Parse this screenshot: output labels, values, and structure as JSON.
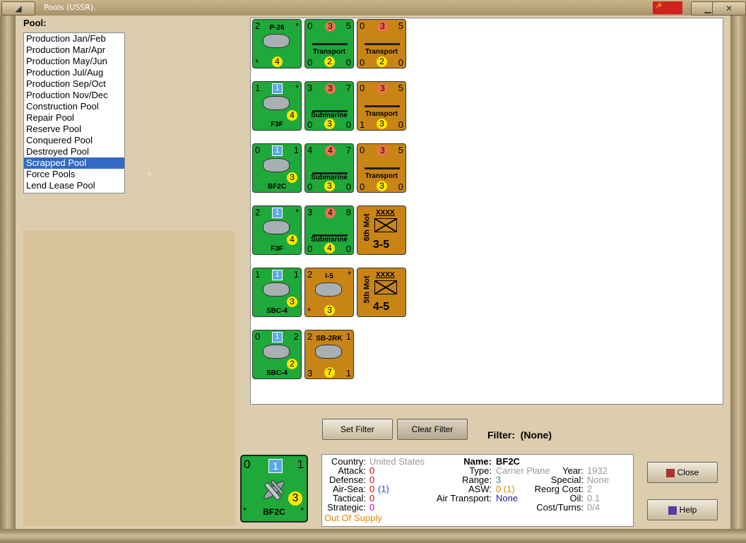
{
  "window": {
    "title": "Pools (USSR)."
  },
  "pool_label": "Pool:",
  "pools": [
    "Production Jan/Feb",
    "Production Mar/Apr",
    "Production May/Jun",
    "Production Jul/Aug",
    "Production Sep/Oct",
    "Production Nov/Dec",
    "Construction Pool",
    "Repair Pool",
    "Reserve Pool",
    "Conquered Pool",
    "Destroyed Pool",
    "Scrapped Pool",
    "Force Pools",
    "Lend Lease Pool"
  ],
  "selected_pool": "Scrapped Pool",
  "counters": [
    {
      "tl": "2",
      "name": "P-26",
      "tr": "*",
      "bl": "*",
      "mid": "4"
    },
    {
      "tl": "0",
      "red": "3",
      "tr": "5",
      "name": "Transport",
      "bl": "0",
      "mid": "2",
      "br": "0"
    },
    {
      "tl": "0",
      "red": "3",
      "tr": "5",
      "name": "Transport",
      "bl": "0",
      "mid": "2",
      "br": "0"
    },
    {
      "tl": "1",
      "blue": "1",
      "tr": "*",
      "name": "F3F",
      "mid": "4"
    },
    {
      "tl": "3",
      "red": "3",
      "tr": "7",
      "name": "Submarine",
      "bl": "0",
      "mid": "3",
      "br": "0"
    },
    {
      "tl": "0",
      "red": "3",
      "tr": "5",
      "name": "Transport",
      "bl": "1",
      "mid": "3",
      "br": "0"
    },
    {
      "tl": "0",
      "blue": "1",
      "tr": "1",
      "name": "BF2C",
      "mid": "3"
    },
    {
      "tl": "4",
      "red": "4",
      "tr": "7",
      "name": "Submarine",
      "bl": "0",
      "mid": "3",
      "br": "0"
    },
    {
      "tl": "0",
      "red": "3",
      "tr": "5",
      "name": "Transport",
      "bl": "0",
      "mid": "3",
      "br": "0"
    },
    {
      "tl": "2",
      "blue": "1",
      "tr": "*",
      "name": "F3F",
      "mid": "4"
    },
    {
      "tl": "3",
      "red": "4",
      "tr": "8",
      "name": "Submarine",
      "bl": "0",
      "mid": "4",
      "br": "0"
    },
    {
      "side": "6th Mot",
      "size": "XXXX",
      "str": "3-5"
    },
    {
      "tl": "1",
      "blue": "1",
      "tr": "1",
      "name": "SBC-4",
      "mid": "3"
    },
    {
      "tl": "2",
      "name": "I-5",
      "tr": "*",
      "bl": "*",
      "mid": "3"
    },
    {
      "side": "5th Mot",
      "size": "XXXX",
      "str": "4-5"
    },
    {
      "tl": "0",
      "blue": "1",
      "tr": "2",
      "name": "SBC-4",
      "mid": "2"
    },
    {
      "tl": "2",
      "tr": "1",
      "name": "SB-2RK",
      "bl": "3",
      "mid": "7",
      "br": "1"
    }
  ],
  "buttons": {
    "set_filter": "Set Filter",
    "clear_filter": "Clear Filter",
    "close": "Close",
    "help": "Help"
  },
  "filter": {
    "label": "Filter:",
    "value": "(None)"
  },
  "selected_unit": {
    "tl": "0",
    "blue": "1",
    "tr": "1",
    "mid": "3",
    "name": "BF2C",
    "country_label": "Country:",
    "country": "United States",
    "attack_label": "Attack:",
    "attack": "0",
    "defense_label": "Defense:",
    "defense": "0",
    "airsea_label": "Air-Sea:",
    "airsea": "0",
    "airsea_paren": "(1)",
    "tactical_label": "Tactical:",
    "tactical": "0",
    "strategic_label": "Strategic:",
    "strategic": "0",
    "supply": "Out Of Supply",
    "name_label": "Name:",
    "type_label": "Type:",
    "type": "Carrier Plane",
    "range_label": "Range:",
    "range": "3",
    "asw_label": "ASW:",
    "asw": "0 (1)",
    "airtransport_label": "Air Transport:",
    "airtransport": "None",
    "year_label": "Year:",
    "year": "1932",
    "special_label": "Special:",
    "special": "None",
    "reorg_label": "Reorg Cost:",
    "reorg": "2",
    "oil_label": "Oil:",
    "oil": "0.1",
    "costturns_label": "Cost/Turns:",
    "costturns": "0/4"
  }
}
